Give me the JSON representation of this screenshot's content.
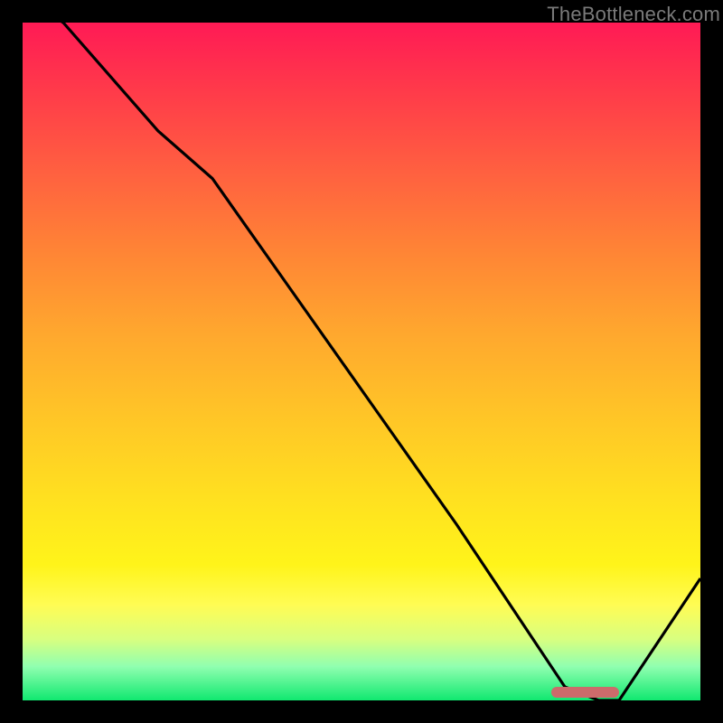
{
  "attribution": "TheBottleneck.com",
  "colors": {
    "background": "#000000",
    "curve": "#000000",
    "marker": "#cc6b6b",
    "gradient_top": "#ff1a55",
    "gradient_bottom": "#10e870"
  },
  "chart_data": {
    "type": "line",
    "title": "",
    "xlabel": "",
    "ylabel": "",
    "xlim": [
      0,
      100
    ],
    "ylim": [
      0,
      100
    ],
    "series": [
      {
        "name": "bottleneck-curve",
        "x": [
          0,
          6,
          20,
          28,
          40,
          52,
          64,
          76,
          80,
          85,
          88,
          100
        ],
        "values": [
          104,
          100,
          84,
          77,
          60,
          43,
          26,
          8,
          2,
          0,
          0,
          18
        ]
      }
    ],
    "marker": {
      "x_start": 78,
      "x_end": 88,
      "y": 1.2
    }
  }
}
